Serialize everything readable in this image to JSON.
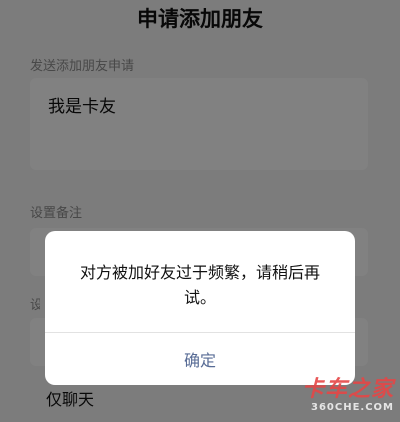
{
  "page": {
    "title": "申请添加朋友"
  },
  "request_section": {
    "label": "发送添加朋友申请",
    "value": "我是卡友"
  },
  "remark_section": {
    "label": "设置备注"
  },
  "permission_section": {
    "label": "设",
    "option": "仅聊天"
  },
  "dialog": {
    "message": "对方被加好友过于频繁，请稍后再试。",
    "confirm_label": "确定"
  },
  "watermark": {
    "main": "卡车之家",
    "sub": "360CHE.COM"
  },
  "colors": {
    "confirm_text": "#576b95",
    "watermark_red": "#e64646"
  }
}
